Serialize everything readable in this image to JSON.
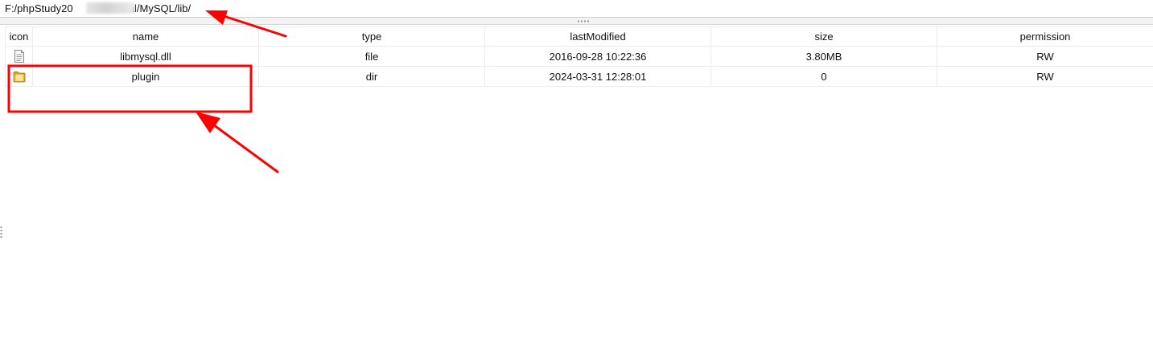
{
  "path_bar": {
    "value_before": "F:/phpStudy20",
    "value_after": "rial/MySQL/lib/"
  },
  "table": {
    "columns": [
      "icon",
      "name",
      "type",
      "lastModified",
      "size",
      "permission"
    ],
    "rows": [
      {
        "icon": "file-icon",
        "name": "libmysql.dll",
        "type": "file",
        "lastModified": "2016-09-28 10:22:36",
        "size": "3.80MB",
        "permission": "RW"
      },
      {
        "icon": "folder-icon",
        "name": "plugin",
        "type": "dir",
        "lastModified": "2024-03-31 12:28:01",
        "size": "0",
        "permission": "RW"
      }
    ]
  },
  "annotations": {
    "color": "#ff0000"
  }
}
